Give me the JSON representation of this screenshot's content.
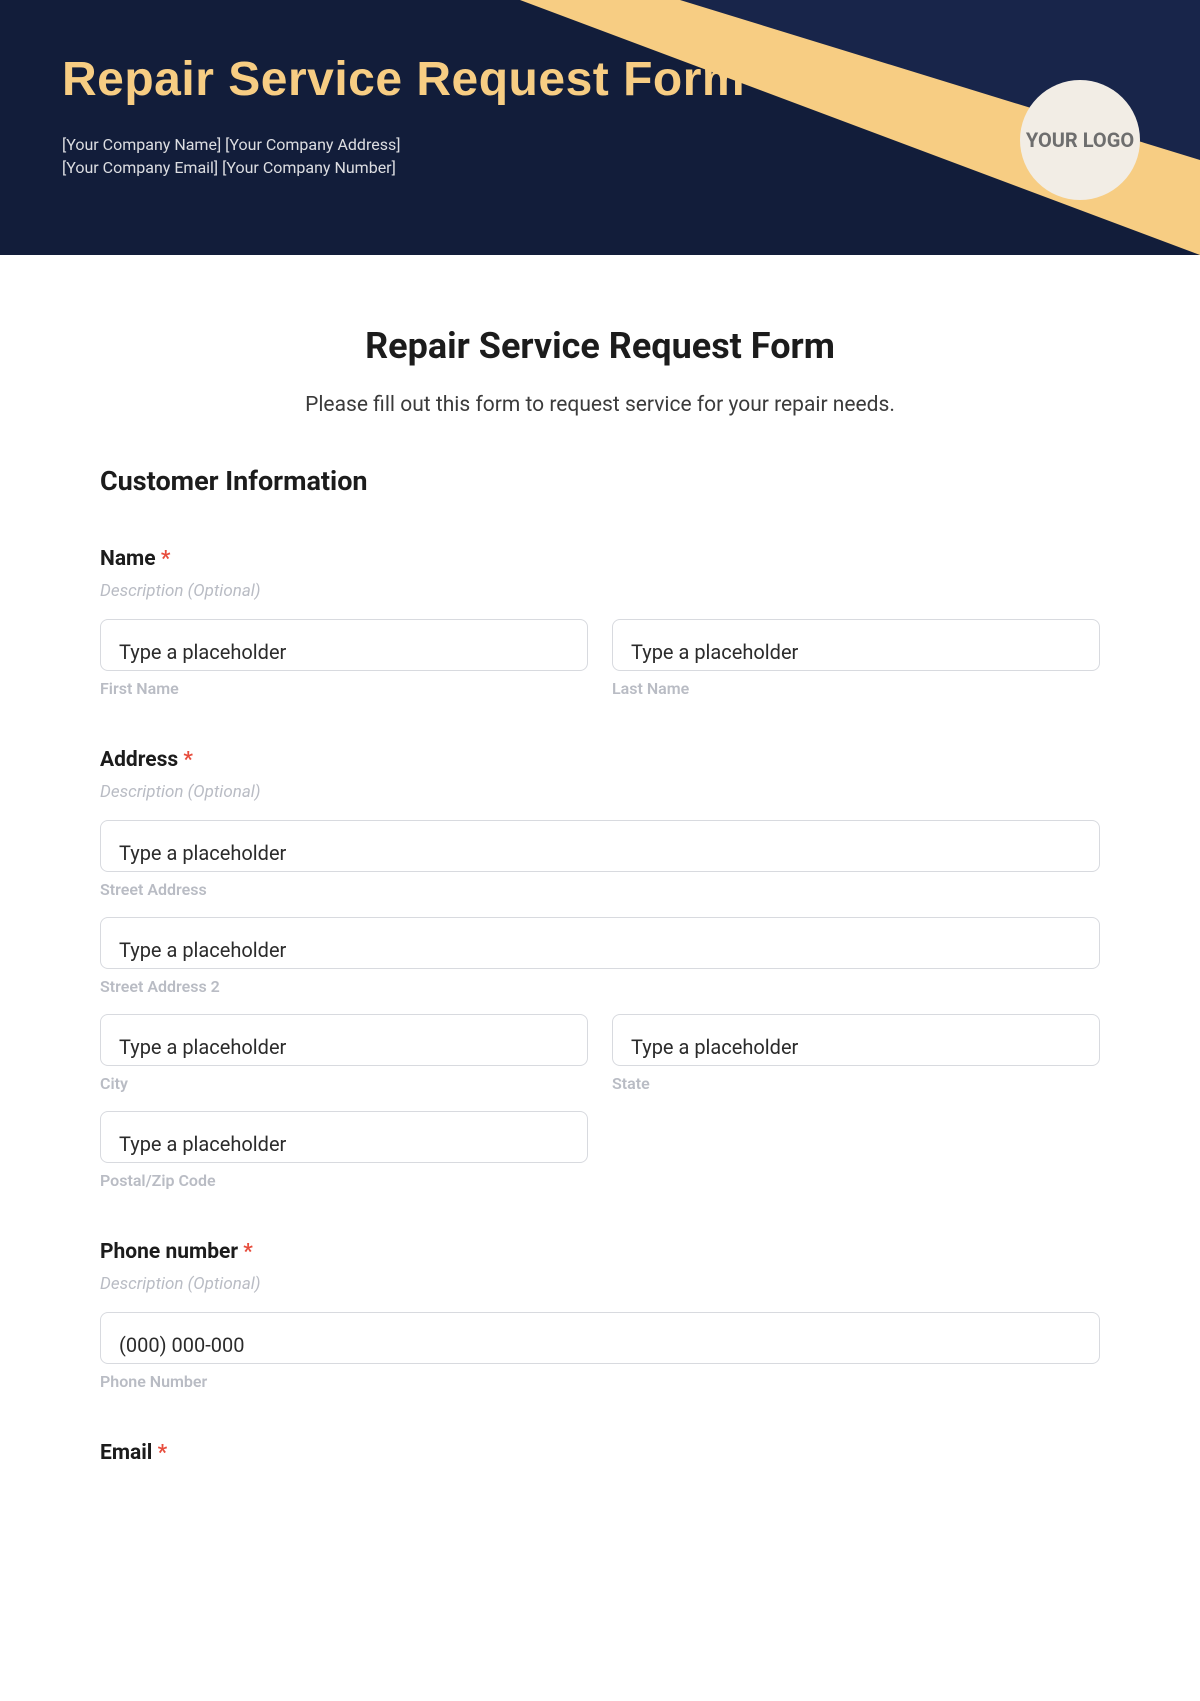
{
  "header": {
    "title": "Repair Service Request Form",
    "line1": "[Your Company Name] [Your Company Address]",
    "line2": "[Your Company Email] [Your Company Number]",
    "logo_text": "YOUR LOGO"
  },
  "form": {
    "title": "Repair Service Request Form",
    "subtitle": "Please fill out this form to request service for your repair needs.",
    "section_customer": "Customer Information",
    "name": {
      "label": "Name",
      "required": "*",
      "desc": "Description (Optional)",
      "first_placeholder": "Type a placeholder",
      "first_sub": "First Name",
      "last_placeholder": "Type a placeholder",
      "last_sub": "Last Name"
    },
    "address": {
      "label": "Address",
      "required": "*",
      "desc": "Description (Optional)",
      "street_placeholder": "Type a placeholder",
      "street_sub": "Street Address",
      "street2_placeholder": "Type a placeholder",
      "street2_sub": "Street Address 2",
      "city_placeholder": "Type a placeholder",
      "city_sub": "City",
      "state_placeholder": "Type a placeholder",
      "state_sub": "State",
      "postal_placeholder": "Type a placeholder",
      "postal_sub": "Postal/Zip Code"
    },
    "phone": {
      "label": "Phone number",
      "required": "*",
      "desc": "Description (Optional)",
      "placeholder": "(000) 000-000",
      "sub": "Phone Number"
    },
    "email": {
      "label": "Email",
      "required": "*"
    }
  }
}
